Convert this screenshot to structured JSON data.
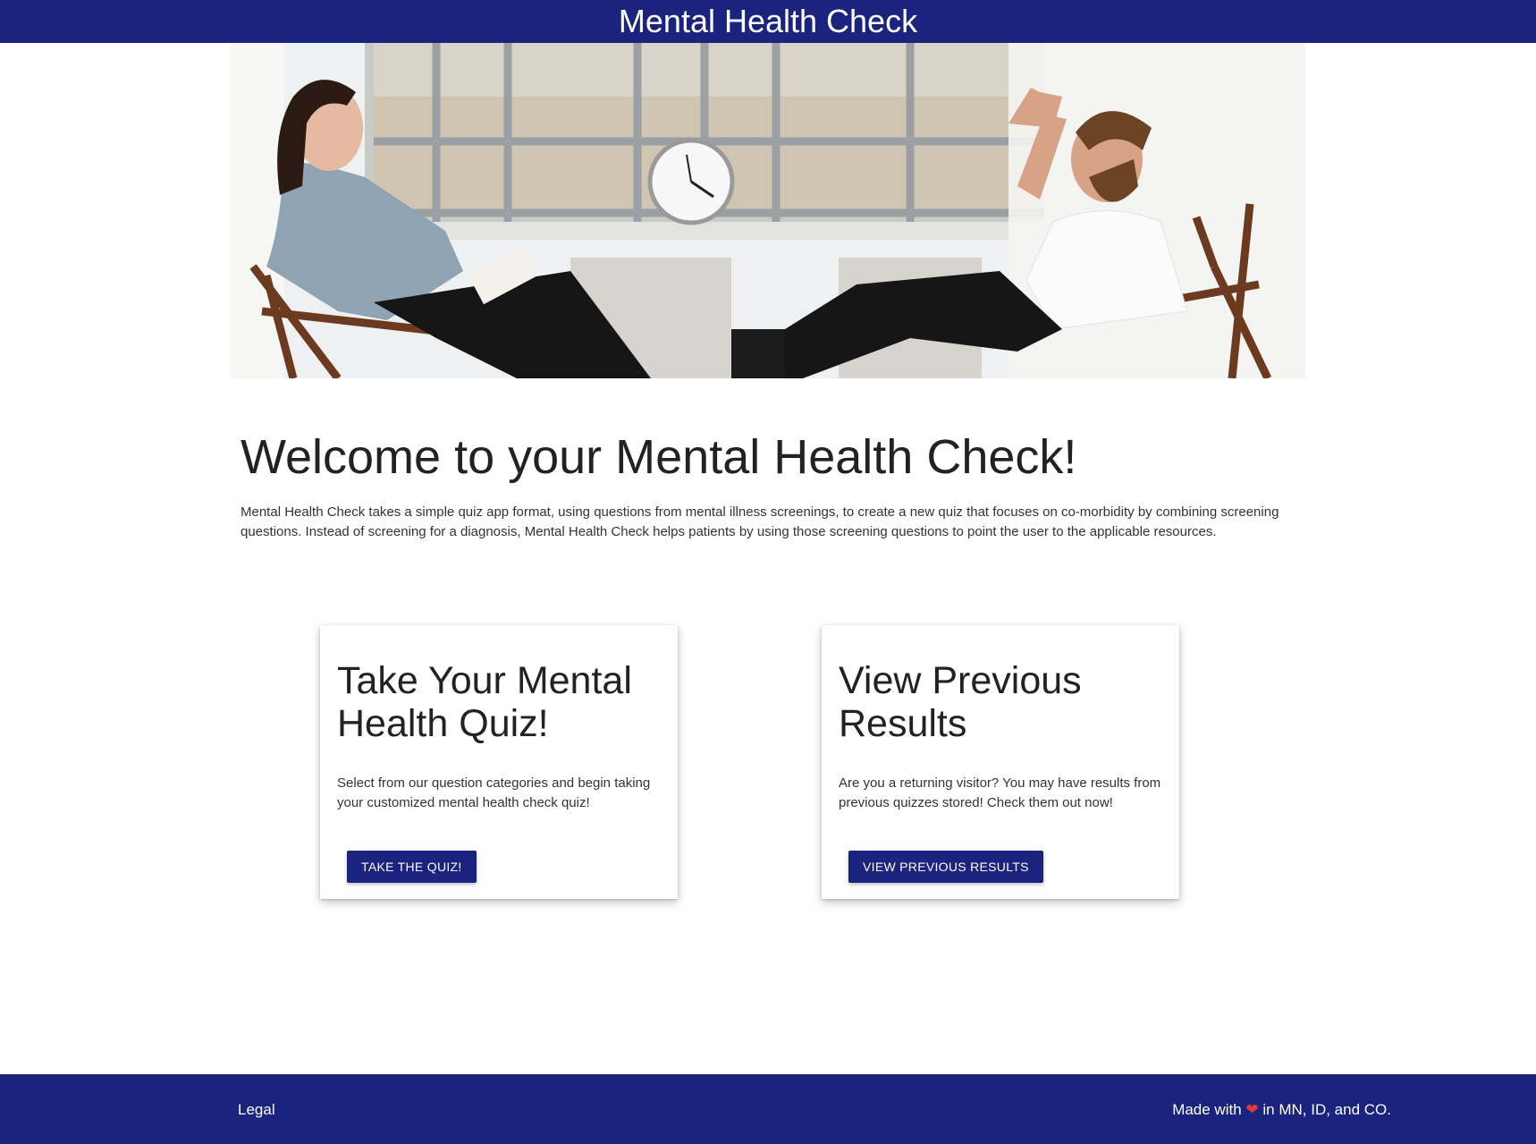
{
  "header": {
    "title": "Mental Health Check"
  },
  "hero": {
    "image_alt": "therapist-and-patient-photo"
  },
  "welcome": {
    "heading": "Welcome to your Mental Health Check!",
    "description": "Mental Health Check takes a simple quiz app format, using questions from mental illness screenings, to create a new quiz that focuses on co-morbidity by combining screening questions. Instead of screening for a diagnosis, Mental Health Check helps patients by using those screening questions to point the user to the applicable resources."
  },
  "cards": [
    {
      "title": "Take Your Mental Health Quiz!",
      "text": "Select from our question categories and begin taking your customized mental health check quiz!",
      "button": "Take the Quiz!"
    },
    {
      "title": "View Previous Results",
      "text": "Are you a returning visitor? You may have results from previous quizzes stored! Check them out now!",
      "button": "View Previous Results"
    }
  ],
  "footer": {
    "legal": "Legal",
    "made_prefix": "Made with",
    "made_suffix": "in MN, ID, and CO.",
    "heart_icon": "heart-icon"
  },
  "colors": {
    "primary": "#1a237e",
    "heart": "#e53935"
  }
}
